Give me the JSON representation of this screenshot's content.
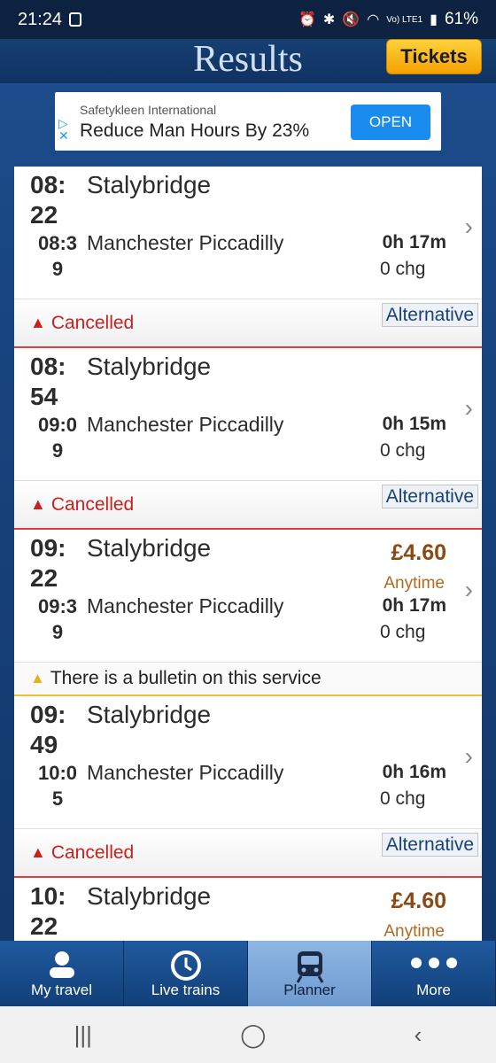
{
  "statusbar": {
    "time": "21:24",
    "network": "Vo) LTE1",
    "battery": "61%"
  },
  "header": {
    "title": "Results",
    "tickets_label": "Tickets"
  },
  "ad": {
    "advertiser": "Safetykleen International",
    "headline": "Reduce Man Hours By 23%",
    "cta": "OPEN"
  },
  "journeys": [
    {
      "dep_time": "08:\n22",
      "from": "Stalybridge",
      "arr_time": "08:3\n9",
      "to": "Manchester Piccadilly",
      "duration": "0h 17m",
      "changes": "0 chg",
      "price": "",
      "fare_type": "",
      "status": "Cancelled",
      "alternative_label": "Alternative"
    },
    {
      "dep_time": "08:\n54",
      "from": "Stalybridge",
      "arr_time": "09:0\n9",
      "to": "Manchester Piccadilly",
      "duration": "0h 15m",
      "changes": "0 chg",
      "price": "",
      "fare_type": "",
      "status": "Cancelled",
      "alternative_label": "Alternative"
    },
    {
      "dep_time": "09:\n22",
      "from": "Stalybridge",
      "arr_time": "09:3\n9",
      "to": "Manchester Piccadilly",
      "duration": "0h 17m",
      "changes": "0 chg",
      "price": "£4.60",
      "fare_type": "Anytime",
      "bulletin": "There is a bulletin on this service"
    },
    {
      "dep_time": "09:\n49",
      "from": "Stalybridge",
      "arr_time": "10:0\n5",
      "to": "Manchester Piccadilly",
      "duration": "0h 16m",
      "changes": "0 chg",
      "price": "",
      "fare_type": "",
      "status": "Cancelled",
      "alternative_label": "Alternative"
    },
    {
      "dep_time": "10:\n22",
      "from": "Stalybridge",
      "price": "£4.60",
      "fare_type": "Anytime"
    }
  ],
  "bottom_nav": [
    {
      "label": "My travel",
      "icon": "person-icon"
    },
    {
      "label": "Live trains",
      "icon": "clock-icon"
    },
    {
      "label": "Planner",
      "icon": "train-icon",
      "active": true
    },
    {
      "label": "More",
      "icon": "more-dots-icon"
    }
  ]
}
